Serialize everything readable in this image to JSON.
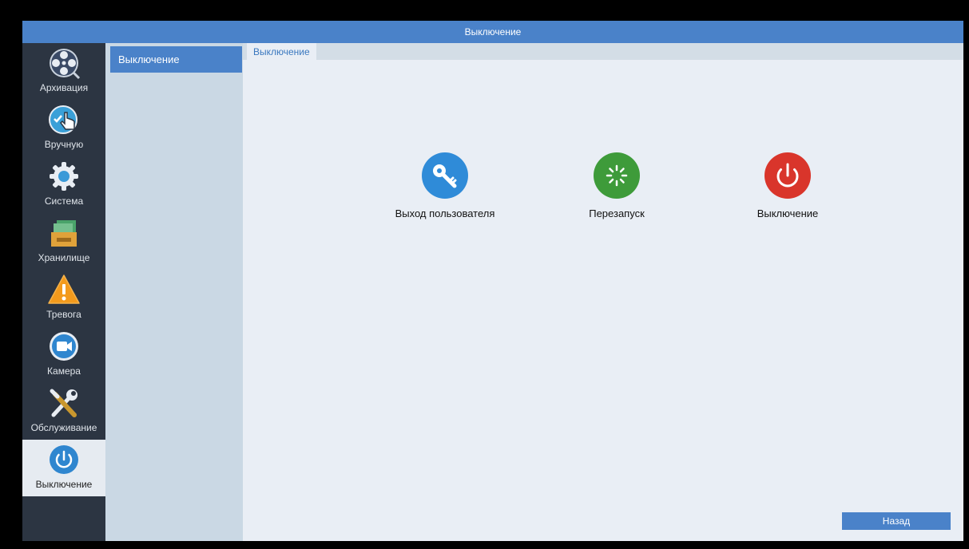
{
  "window": {
    "title": "Выключение"
  },
  "sidebar": {
    "items": [
      {
        "label": "Архивация",
        "icon": "film-reel-icon"
      },
      {
        "label": "Вручную",
        "icon": "hand-pointer-icon"
      },
      {
        "label": "Система",
        "icon": "gear-icon"
      },
      {
        "label": "Хранилище",
        "icon": "storage-icon"
      },
      {
        "label": "Тревога",
        "icon": "warning-icon"
      },
      {
        "label": "Камера",
        "icon": "camera-icon"
      },
      {
        "label": "Обслуживание",
        "icon": "tools-icon"
      },
      {
        "label": "Выключение",
        "icon": "power-icon",
        "active": true
      }
    ]
  },
  "submenu": {
    "items": [
      {
        "label": "Выключение",
        "active": true
      }
    ]
  },
  "tabs": [
    {
      "label": "Выключение",
      "active": true
    }
  ],
  "actions": [
    {
      "label": "Выход пользователя",
      "icon": "key-icon",
      "color": "#2f8bd8"
    },
    {
      "label": "Перезапуск",
      "icon": "restart-icon",
      "color": "#3e9b3a"
    },
    {
      "label": "Выключение",
      "icon": "power-icon",
      "color": "#d9352b"
    }
  ],
  "footer": {
    "back_label": "Назад"
  },
  "colors": {
    "accent": "#4a82c9",
    "sidebar_bg": "#2c3542",
    "submenu_bg": "#cad8e4",
    "content_bg": "#e9eef5"
  }
}
